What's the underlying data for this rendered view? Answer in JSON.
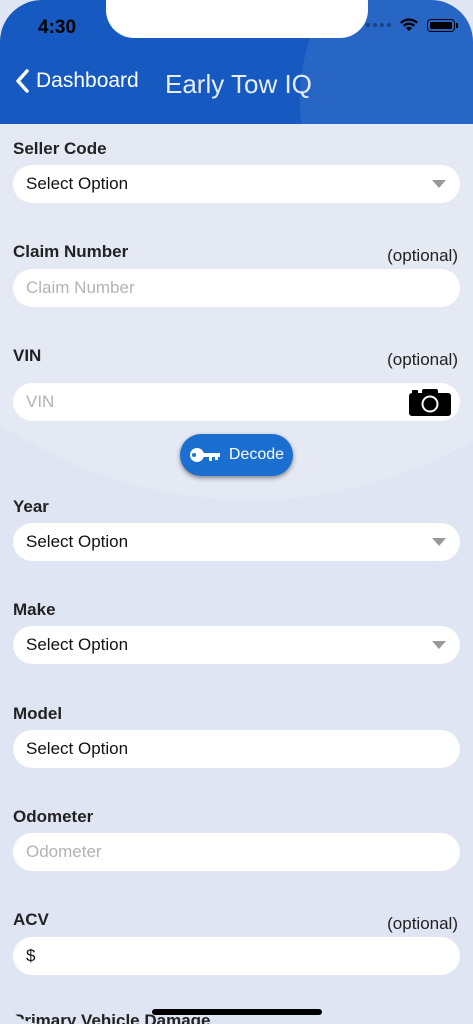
{
  "status_bar": {
    "time": "4:30"
  },
  "nav": {
    "back_label": "Dashboard",
    "title": "Early Tow IQ"
  },
  "form": {
    "seller_code": {
      "label": "Seller Code",
      "value": "Select Option"
    },
    "claim_number": {
      "label": "Claim Number",
      "optional": "(optional)",
      "placeholder": "Claim Number"
    },
    "vin": {
      "label": "VIN",
      "optional": "(optional)",
      "placeholder": "VIN"
    },
    "decode_button": "Decode",
    "year": {
      "label": "Year",
      "value": "Select Option"
    },
    "make": {
      "label": "Make",
      "value": "Select Option"
    },
    "model": {
      "label": "Model",
      "value": "Select Option"
    },
    "odometer": {
      "label": "Odometer",
      "placeholder": "Odometer"
    },
    "acv": {
      "label": "ACV",
      "optional": "(optional)",
      "value": "$"
    },
    "next_label": "Primary Vehicle Damage"
  }
}
